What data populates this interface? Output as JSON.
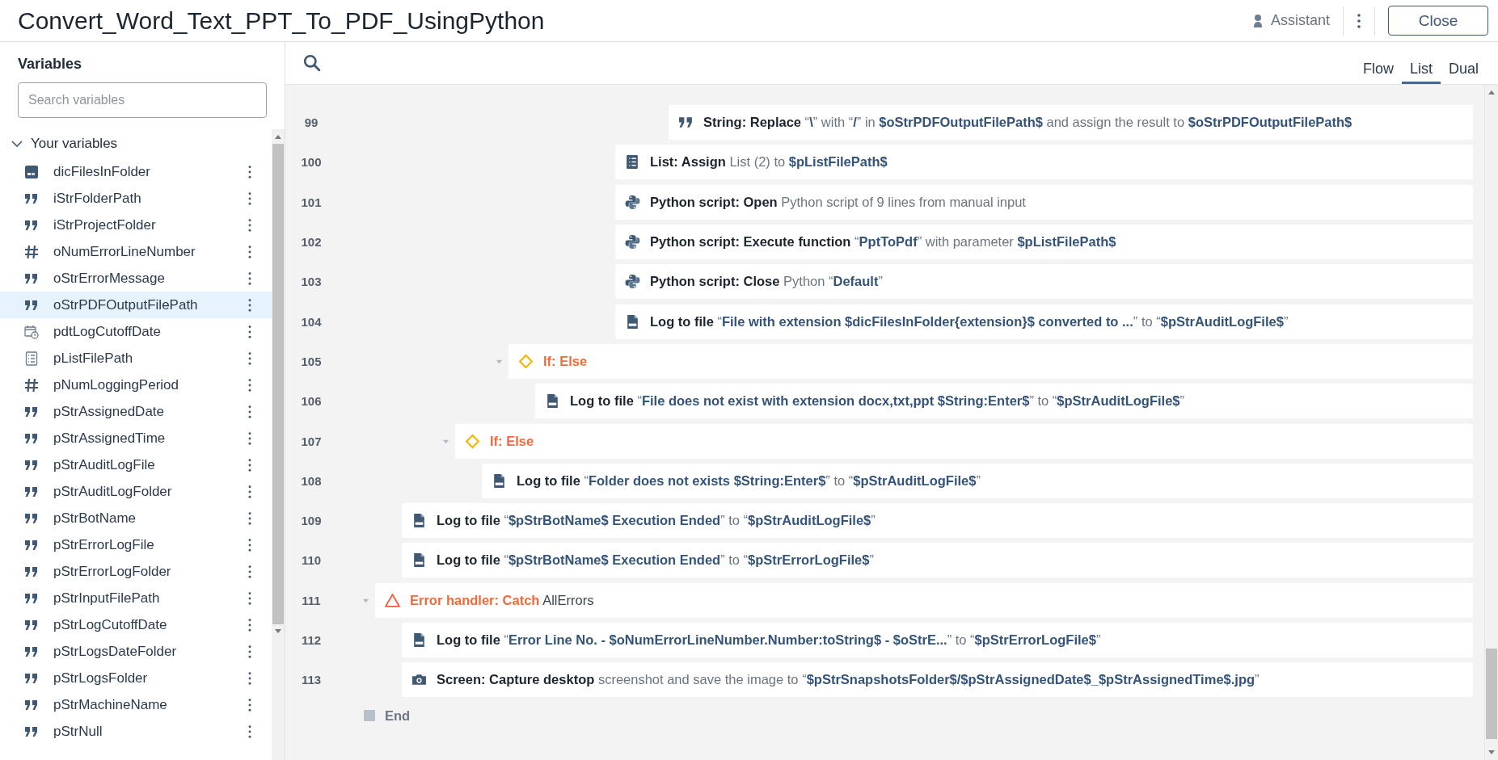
{
  "window": {
    "title": "Convert_Word_Text_PPT_To_PDF_UsingPython"
  },
  "header": {
    "assistant": "Assistant",
    "close": "Close"
  },
  "sidebar": {
    "title": "Variables",
    "search": {
      "placeholder": "Search variables"
    },
    "group": {
      "label": "Your variables",
      "expanded": true
    },
    "variables": [
      {
        "name": "dicFilesInFolder",
        "kind": "dictionary",
        "selected": false
      },
      {
        "name": "iStrFolderPath",
        "kind": "string",
        "selected": false
      },
      {
        "name": "iStrProjectFolder",
        "kind": "string",
        "selected": false
      },
      {
        "name": "oNumErrorLineNumber",
        "kind": "number",
        "selected": false
      },
      {
        "name": "oStrErrorMessage",
        "kind": "string",
        "selected": false
      },
      {
        "name": "oStrPDFOutputFilePath",
        "kind": "string",
        "selected": true
      },
      {
        "name": "pdtLogCutoffDate",
        "kind": "datetime",
        "selected": false
      },
      {
        "name": "pListFilePath",
        "kind": "list",
        "selected": false
      },
      {
        "name": "pNumLoggingPeriod",
        "kind": "number",
        "selected": false
      },
      {
        "name": "pStrAssignedDate",
        "kind": "string",
        "selected": false
      },
      {
        "name": "pStrAssignedTime",
        "kind": "string",
        "selected": false
      },
      {
        "name": "pStrAuditLogFile",
        "kind": "string",
        "selected": false
      },
      {
        "name": "pStrAuditLogFolder",
        "kind": "string",
        "selected": false
      },
      {
        "name": "pStrBotName",
        "kind": "string",
        "selected": false
      },
      {
        "name": "pStrErrorLogFile",
        "kind": "string",
        "selected": false
      },
      {
        "name": "pStrErrorLogFolder",
        "kind": "string",
        "selected": false
      },
      {
        "name": "pStrInputFilePath",
        "kind": "string",
        "selected": false
      },
      {
        "name": "pStrLogCutoffDate",
        "kind": "string",
        "selected": false
      },
      {
        "name": "pStrLogsDateFolder",
        "kind": "string",
        "selected": false
      },
      {
        "name": "pStrLogsFolder",
        "kind": "string",
        "selected": false
      },
      {
        "name": "pStrMachineName",
        "kind": "string",
        "selected": false
      },
      {
        "name": "pStrNull",
        "kind": "string",
        "selected": false
      }
    ]
  },
  "view_tabs": [
    {
      "label": "Flow",
      "selected": false
    },
    {
      "label": "List",
      "selected": true
    },
    {
      "label": "Dual",
      "selected": false
    }
  ],
  "steps": [
    {
      "children": [
        {
          "children": [
            {
              "children": [
                {
                  "children": [
                    {
                      "children": [
                        {
                          "children": [
                            {
                              "children": [
                                {
                                  "children": [
                                    {
                                      "children": [
                                        {
                                          "children": [
                                            {
                                              "children": [
                                                {
                                                  "line": "99",
                                                  "kind": "string",
                                                  "parts": [
                                                    {
                                                      "kind": "action",
                                                      "text": "String: Replace"
                                                    },
                                                    {
                                                      "kind": "plain",
                                                      "text": " “"
                                                    },
                                                    {
                                                      "kind": "value",
                                                      "text": "\\"
                                                    },
                                                    {
                                                      "kind": "plain",
                                                      "text": "” with “"
                                                    },
                                                    {
                                                      "kind": "value",
                                                      "text": "/"
                                                    },
                                                    {
                                                      "kind": "plain",
                                                      "text": "” in "
                                                    },
                                                    {
                                                      "kind": "value",
                                                      "text": "$oStrPDFOutputFilePath$"
                                                    },
                                                    {
                                                      "kind": "plain",
                                                      "text": " and assign the result to "
                                                    },
                                                    {
                                                      "kind": "value",
                                                      "text": "$oStrPDFOutputFilePath$"
                                                    }
                                                  ]
                                                }
                                              ]
                                            }
                                          ]
                                        },
                                        {
                                          "line": "100",
                                          "kind": "list",
                                          "parts": [
                                            {
                                              "kind": "action",
                                              "text": "List: Assign"
                                            },
                                            {
                                              "kind": "plain",
                                              "text": " List (2) to "
                                            },
                                            {
                                              "kind": "value",
                                              "text": "$pListFilePath$"
                                            }
                                          ]
                                        },
                                        {
                                          "line": "101",
                                          "kind": "python",
                                          "parts": [
                                            {
                                              "kind": "action",
                                              "text": "Python script: Open"
                                            },
                                            {
                                              "kind": "plain",
                                              "text": " Python script of 9 lines from manual input"
                                            }
                                          ]
                                        },
                                        {
                                          "line": "102",
                                          "kind": "python",
                                          "parts": [
                                            {
                                              "kind": "action",
                                              "text": "Python script: Execute function"
                                            },
                                            {
                                              "kind": "plain",
                                              "text": " “"
                                            },
                                            {
                                              "kind": "value",
                                              "text": "PptToPdf"
                                            },
                                            {
                                              "kind": "plain",
                                              "text": "” with parameter "
                                            },
                                            {
                                              "kind": "value",
                                              "text": "$pListFilePath$"
                                            }
                                          ]
                                        },
                                        {
                                          "line": "103",
                                          "kind": "python",
                                          "parts": [
                                            {
                                              "kind": "action",
                                              "text": "Python script: Close"
                                            },
                                            {
                                              "kind": "plain",
                                              "text": " Python “"
                                            },
                                            {
                                              "kind": "value",
                                              "text": "Default"
                                            },
                                            {
                                              "kind": "plain",
                                              "text": "”"
                                            }
                                          ]
                                        },
                                        {
                                          "line": "104",
                                          "kind": "log",
                                          "parts": [
                                            {
                                              "kind": "action",
                                              "text": "Log to file"
                                            },
                                            {
                                              "kind": "plain",
                                              "text": " “"
                                            },
                                            {
                                              "kind": "value",
                                              "text": "File with extension $dicFilesInFolder{extension}$ converted to ..."
                                            },
                                            {
                                              "kind": "plain",
                                              "text": "” to “"
                                            },
                                            {
                                              "kind": "value",
                                              "text": "$pStrAuditLogFile$"
                                            },
                                            {
                                              "kind": "plain",
                                              "text": "”"
                                            }
                                          ]
                                        }
                                      ]
                                    }
                                  ]
                                }
                              ]
                            }
                          ]
                        },
                        {
                          "line": "105",
                          "kind": "if",
                          "expanded": true,
                          "parts": [
                            {
                              "kind": "control",
                              "text": "If: Else"
                            }
                          ],
                          "children": [
                            {
                              "line": "106",
                              "kind": "log",
                              "parts": [
                                {
                                  "kind": "action",
                                  "text": "Log to file"
                                },
                                {
                                  "kind": "plain",
                                  "text": " “"
                                },
                                {
                                  "kind": "value",
                                  "text": "File does not exist with extension docx,txt,ppt $String:Enter$"
                                },
                                {
                                  "kind": "plain",
                                  "text": "” to “"
                                },
                                {
                                  "kind": "value",
                                  "text": "$pStrAuditLogFile$"
                                },
                                {
                                  "kind": "plain",
                                  "text": "”"
                                }
                              ]
                            }
                          ]
                        }
                      ]
                    }
                  ]
                },
                {
                  "line": "107",
                  "kind": "if",
                  "expanded": true,
                  "parts": [
                    {
                      "kind": "control",
                      "text": "If: Else"
                    }
                  ],
                  "children": [
                    {
                      "line": "108",
                      "kind": "log",
                      "parts": [
                        {
                          "kind": "action",
                          "text": "Log to file"
                        },
                        {
                          "kind": "plain",
                          "text": " “"
                        },
                        {
                          "kind": "value",
                          "text": "Folder does not exists $String:Enter$"
                        },
                        {
                          "kind": "plain",
                          "text": "” to “"
                        },
                        {
                          "kind": "value",
                          "text": "$pStrAuditLogFile$"
                        },
                        {
                          "kind": "plain",
                          "text": "”"
                        }
                      ]
                    }
                  ]
                }
              ]
            }
          ]
        },
        {
          "line": "109",
          "kind": "log",
          "parts": [
            {
              "kind": "action",
              "text": "Log to file"
            },
            {
              "kind": "plain",
              "text": " “"
            },
            {
              "kind": "value",
              "text": "$pStrBotName$ Execution Ended"
            },
            {
              "kind": "plain",
              "text": "” to “"
            },
            {
              "kind": "value",
              "text": "$pStrAuditLogFile$"
            },
            {
              "kind": "plain",
              "text": "”"
            }
          ]
        },
        {
          "line": "110",
          "kind": "log",
          "parts": [
            {
              "kind": "action",
              "text": "Log to file"
            },
            {
              "kind": "plain",
              "text": " “"
            },
            {
              "kind": "value",
              "text": "$pStrBotName$ Execution Ended"
            },
            {
              "kind": "plain",
              "text": "” to “"
            },
            {
              "kind": "value",
              "text": "$pStrErrorLogFile$"
            },
            {
              "kind": "plain",
              "text": "”"
            }
          ]
        }
      ]
    },
    {
      "line": "111",
      "kind": "error",
      "expanded": true,
      "parts": [
        {
          "kind": "control",
          "text": "Error handler: Catch"
        },
        {
          "kind": "plain-dark",
          "text": " AllErrors"
        }
      ],
      "children": [
        {
          "line": "112",
          "kind": "log",
          "parts": [
            {
              "kind": "action",
              "text": "Log to file"
            },
            {
              "kind": "plain",
              "text": " “"
            },
            {
              "kind": "value",
              "text": "Error Line No. - $oNumErrorLineNumber.Number:toString$ - $oStrE..."
            },
            {
              "kind": "plain",
              "text": "” to “"
            },
            {
              "kind": "value",
              "text": "$pStrErrorLogFile$"
            },
            {
              "kind": "plain",
              "text": "”"
            }
          ]
        },
        {
          "line": "113",
          "kind": "camera",
          "parts": [
            {
              "kind": "action",
              "text": "Screen: Capture desktop"
            },
            {
              "kind": "plain",
              "text": " screenshot and save the image to “"
            },
            {
              "kind": "value",
              "text": "$pStrSnapshotsFolder$/$pStrAssignedDate$_$pStrAssignedTime$.jpg"
            },
            {
              "kind": "plain",
              "text": "”"
            }
          ]
        }
      ]
    }
  ],
  "end": {
    "label": "End"
  }
}
